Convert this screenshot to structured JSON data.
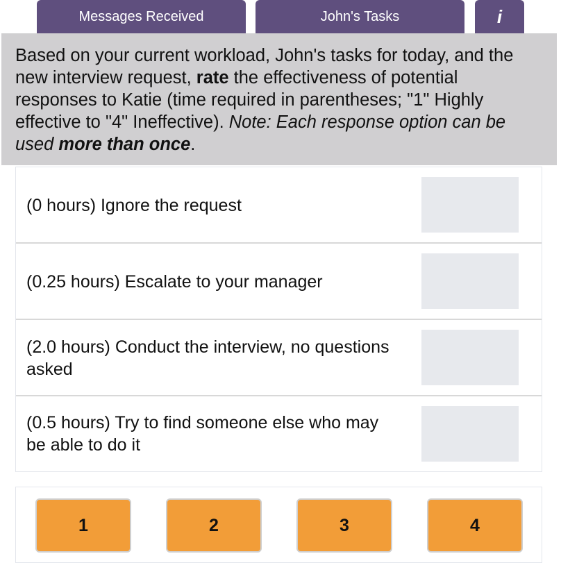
{
  "tabs": [
    {
      "label": "Messages Received"
    },
    {
      "label": "John's Tasks"
    },
    {
      "label": "i",
      "icon": "info-icon"
    }
  ],
  "instructions": {
    "part1": "Based on your current workload, John's tasks for today, and the new interview request, ",
    "bold1": "rate",
    "part2": " the effectiveness of potential responses to Katie (time required in parentheses; \"1\" Highly effective to \"4\" Ineffective). ",
    "italic1": "Note: Each response option can be used ",
    "italic_bold": "more than once",
    "end": "."
  },
  "responses": [
    {
      "text": "(0 hours) Ignore the request",
      "rating": ""
    },
    {
      "text": "(0.25 hours) Escalate to your manager",
      "rating": ""
    },
    {
      "text": "(2.0 hours) Conduct the interview, no questions asked",
      "rating": ""
    },
    {
      "text": "(0.5 hours) Try to find someone else who may be able to do it",
      "rating": ""
    }
  ],
  "rating_buttons": [
    {
      "label": "1"
    },
    {
      "label": "2"
    },
    {
      "label": "3"
    },
    {
      "label": "4"
    }
  ],
  "colors": {
    "tab": "#5f4f7e",
    "instruction_bg": "#d0cfd1",
    "drop_box": "#e7e9ed",
    "rating_button": "#f29d38"
  }
}
